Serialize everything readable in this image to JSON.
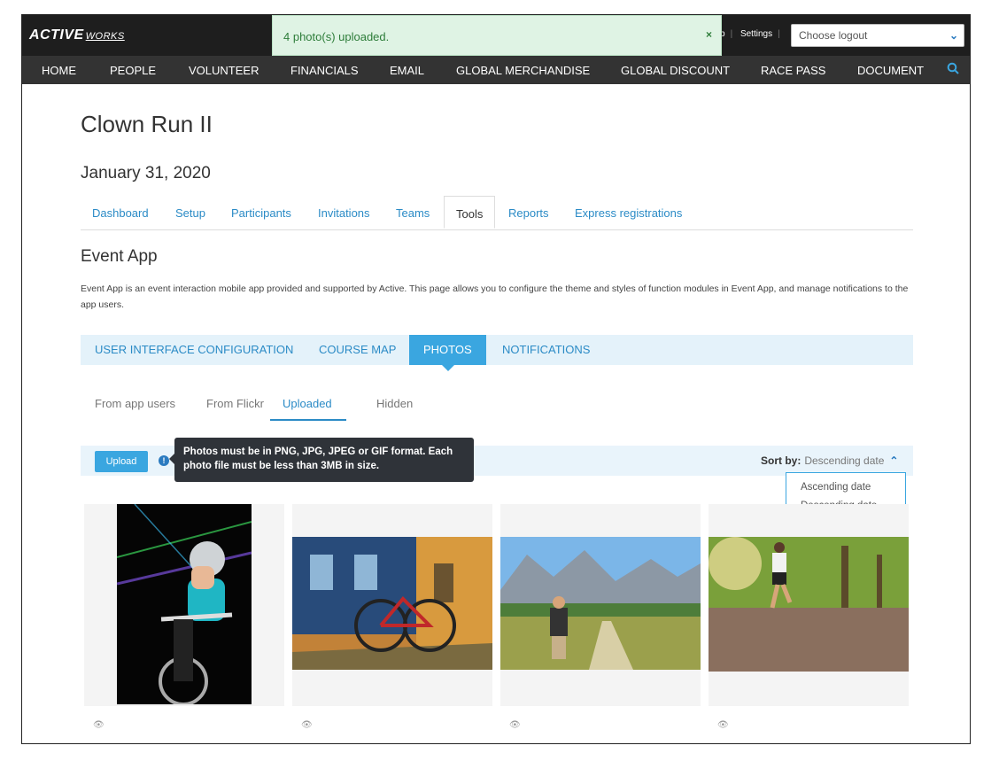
{
  "app": {
    "logo_main": "ACTIVE",
    "logo_sub": "WORKS"
  },
  "topbar": {
    "help_fragment": "p",
    "settings": "Settings",
    "logout_select": "Choose logout"
  },
  "toast": {
    "message": "4 photo(s) uploaded.",
    "close": "×"
  },
  "nav": {
    "items": [
      "HOME",
      "PEOPLE",
      "VOLUNTEER",
      "FINANCIALS",
      "EMAIL",
      "GLOBAL MERCHANDISE",
      "GLOBAL DISCOUNT",
      "RACE PASS",
      "DOCUMENT"
    ]
  },
  "page": {
    "title": "Clown Run II",
    "date": "January 31, 2020",
    "tabs": [
      "Dashboard",
      "Setup",
      "Participants",
      "Invitations",
      "Teams",
      "Tools",
      "Reports",
      "Express registrations"
    ],
    "active_tab": "Tools",
    "section_title": "Event App",
    "description": "Event App is an event interaction mobile app provided and supported by Active. This page allows you to configure the theme and styles of function modules in Event App, and manage notifications to the app users."
  },
  "subnav": {
    "items": [
      "USER INTERFACE CONFIGURATION",
      "COURSE MAP",
      "PHOTOS",
      "NOTIFICATIONS"
    ],
    "active": "PHOTOS"
  },
  "photo_tabs": {
    "items": [
      "From app users",
      "From Flickr",
      "Uploaded",
      "Hidden"
    ],
    "active": "Uploaded"
  },
  "toolbar": {
    "upload_label": "Upload",
    "tooltip": "Photos must be in PNG, JPG, JPEG or GIF format. Each photo file must be less than 3MB in size.",
    "sort_label": "Sort by:",
    "sort_value": "Descending date",
    "sort_options": [
      "Ascending date",
      "Descending date"
    ]
  },
  "photos": [
    {
      "subject": "cyclist"
    },
    {
      "subject": "bicycle"
    },
    {
      "subject": "hiker"
    },
    {
      "subject": "runner"
    }
  ],
  "colors": {
    "accent": "#3aa6e0",
    "link": "#2b8bc6",
    "nav_bg": "#333333",
    "toast_bg": "#dff3e4"
  }
}
